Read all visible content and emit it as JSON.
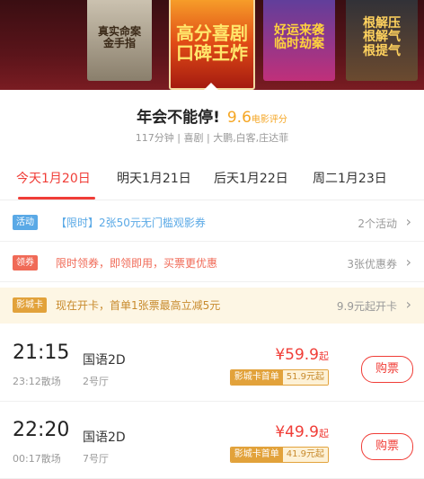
{
  "posters": [
    {
      "lines": [
        "真实命案",
        "金手指"
      ]
    },
    {
      "lines": [
        "高分喜剧",
        "口碑王炸"
      ]
    },
    {
      "lines": [
        "好运来袭",
        "临时劫案"
      ]
    },
    {
      "lines": [
        "根解压",
        "根解气",
        "根提气"
      ]
    }
  ],
  "movie": {
    "title": "年会不能停!",
    "score": "9.6",
    "score_label": "电影评分",
    "meta": "117分钟 | 喜剧 | 大鹏,白客,庄达菲"
  },
  "dates": [
    {
      "label": "今天1月20日",
      "active": true
    },
    {
      "label": "明天1月21日"
    },
    {
      "label": "后天1月22日"
    },
    {
      "label": "周二1月23日"
    }
  ],
  "promos": [
    {
      "tag": "活动",
      "text": "【限时】2张50元无门槛观影券",
      "right": "2个活动"
    },
    {
      "tag": "领券",
      "text": "限时领券，即领即用，买票更优惠",
      "right": "3张优惠券"
    },
    {
      "tag": "影城卡",
      "text": "现在开卡，首单1张票最高立减5元",
      "right": "9.9元起开卡"
    }
  ],
  "showtimes": [
    {
      "time": "21:15",
      "end": "23:12散场",
      "lang": "国语2D",
      "hall": "2号厅",
      "price": "¥59.9",
      "price_suffix": "起",
      "card_label": "影城卡首单",
      "card_price": "51.9元起",
      "buy": "购票"
    },
    {
      "time": "22:20",
      "end": "00:17散场",
      "lang": "国语2D",
      "hall": "7号厅",
      "price": "¥49.9",
      "price_suffix": "起",
      "card_label": "影城卡首单",
      "card_price": "41.9元起",
      "buy": "购票"
    }
  ],
  "colors": {
    "accent": "#f03d37",
    "score": "#f5a623",
    "activity_tag": "#5aa9e6",
    "coupon_tag": "#f06a57",
    "card_tag": "#e2a23b"
  }
}
